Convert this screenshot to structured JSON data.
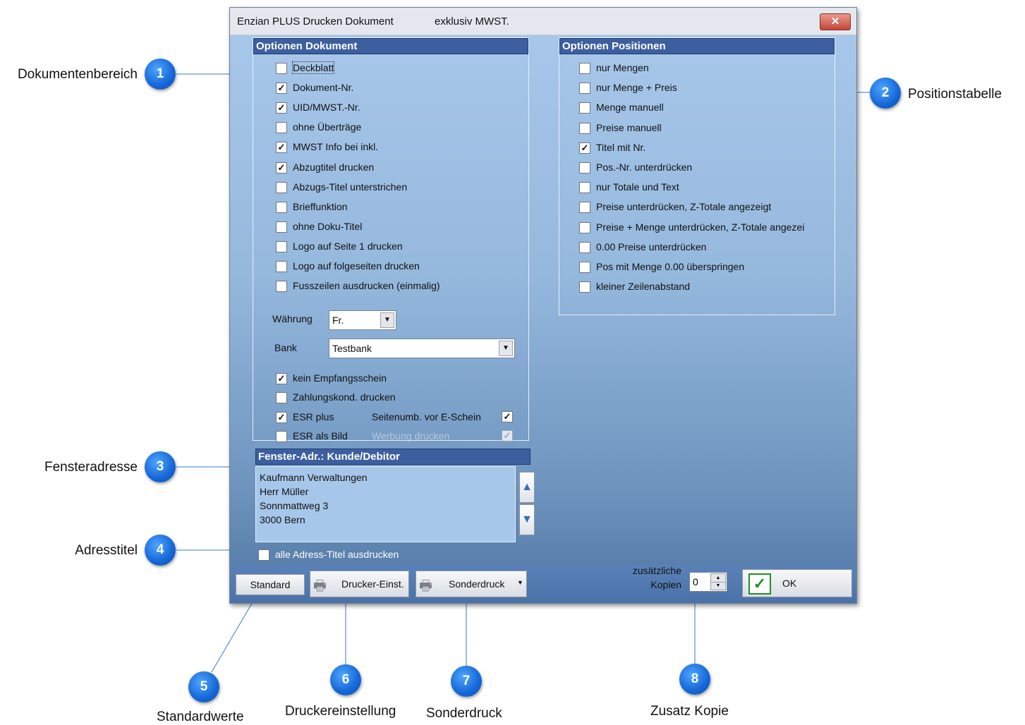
{
  "window": {
    "title": "Enzian PLUS Drucken Dokument",
    "title_extra": "exklusiv MWST.",
    "close_label": "✕"
  },
  "doc_options": {
    "header": "Optionen Dokument",
    "items": [
      {
        "label": "Deckblatt",
        "checked": false
      },
      {
        "label": "Dokument-Nr.",
        "checked": true
      },
      {
        "label": "UID/MWST.-Nr.",
        "checked": true
      },
      {
        "label": "ohne Überträge",
        "checked": false
      },
      {
        "label": "MWST Info bei inkl.",
        "checked": true
      },
      {
        "label": "Abzugtitel drucken",
        "checked": true
      },
      {
        "label": "Abzugs-Titel unterstrichen",
        "checked": false
      },
      {
        "label": "Brieffunktion",
        "checked": false
      },
      {
        "label": "ohne Doku-Titel",
        "checked": false
      },
      {
        "label": "Logo auf Seite 1 drucken",
        "checked": false
      },
      {
        "label": "Logo auf folgeseiten drucken",
        "checked": false
      },
      {
        "label": "Fusszeilen ausdrucken (einmalig)",
        "checked": false
      }
    ],
    "currency_label": "Währung",
    "currency_value": "Fr.",
    "bank_label": "Bank",
    "bank_value": "Testbank",
    "lower_items": [
      {
        "label": "kein Empfangsschein",
        "checked": true
      },
      {
        "label": "Zahlungskond. drucken",
        "checked": false
      },
      {
        "label": "ESR plus",
        "checked": true
      },
      {
        "label": "ESR als Bild",
        "checked": false
      }
    ],
    "page_numbering_label": "Seitenumb. vor E-Schein",
    "page_numbering_checked": true,
    "advertising_label": "Werbung drucken",
    "advertising_checked": true
  },
  "pos_options": {
    "header": "Optionen Positionen",
    "items": [
      {
        "label": "nur Mengen",
        "checked": false
      },
      {
        "label": "nur Menge + Preis",
        "checked": false
      },
      {
        "label": "Menge manuell",
        "checked": false
      },
      {
        "label": "Preise manuell",
        "checked": false
      },
      {
        "label": "Titel mit Nr.",
        "checked": true
      },
      {
        "label": "Pos.-Nr. unterdrücken",
        "checked": false
      },
      {
        "label": "nur Totale und Text",
        "checked": false
      },
      {
        "label": "Preise unterdrücken, Z-Totale angezeigt",
        "checked": false
      },
      {
        "label": "Preise + Menge unterdrücken, Z-Totale angezei",
        "checked": false
      },
      {
        "label": "0.00 Preise unterdrücken",
        "checked": false
      },
      {
        "label": "Pos mit Menge 0.00 überspringen",
        "checked": false
      },
      {
        "label": "kleiner Zeilenabstand",
        "checked": false
      }
    ]
  },
  "window_address": {
    "header": "Fenster-Adr.: Kunde/Debitor",
    "lines": [
      "Kaufmann Verwaltungen",
      "Herr Müller",
      "Sonnmattweg 3",
      "3000 Bern"
    ],
    "all_titles_label": "alle Adress-Titel ausdrucken",
    "all_titles_checked": false
  },
  "footer": {
    "standard_label": "Standard",
    "printer_label": "Drucker-Einst.",
    "special_label": "Sonderdruck",
    "copies_label_1": "zusätzliche",
    "copies_label_2": "Kopien",
    "copies_value": "0",
    "ok_label": "OK"
  },
  "callouts": [
    {
      "num": "1",
      "label": "Dokumentenbereich"
    },
    {
      "num": "2",
      "label": "Positionstabelle"
    },
    {
      "num": "3",
      "label": "Fensteradresse"
    },
    {
      "num": "4",
      "label": "Adresstitel"
    },
    {
      "num": "5",
      "label": "Standardwerte"
    },
    {
      "num": "6",
      "label": "Druckereinstellung"
    },
    {
      "num": "7",
      "label": "Sonderdruck"
    },
    {
      "num": "8",
      "label": "Zusatz Kopie"
    }
  ],
  "colors": {
    "group_header": "#3d5fa0",
    "callout": "#1566d6",
    "window_gradient_top": "#a9c9eb",
    "window_gradient_bottom": "#4f75a3"
  }
}
